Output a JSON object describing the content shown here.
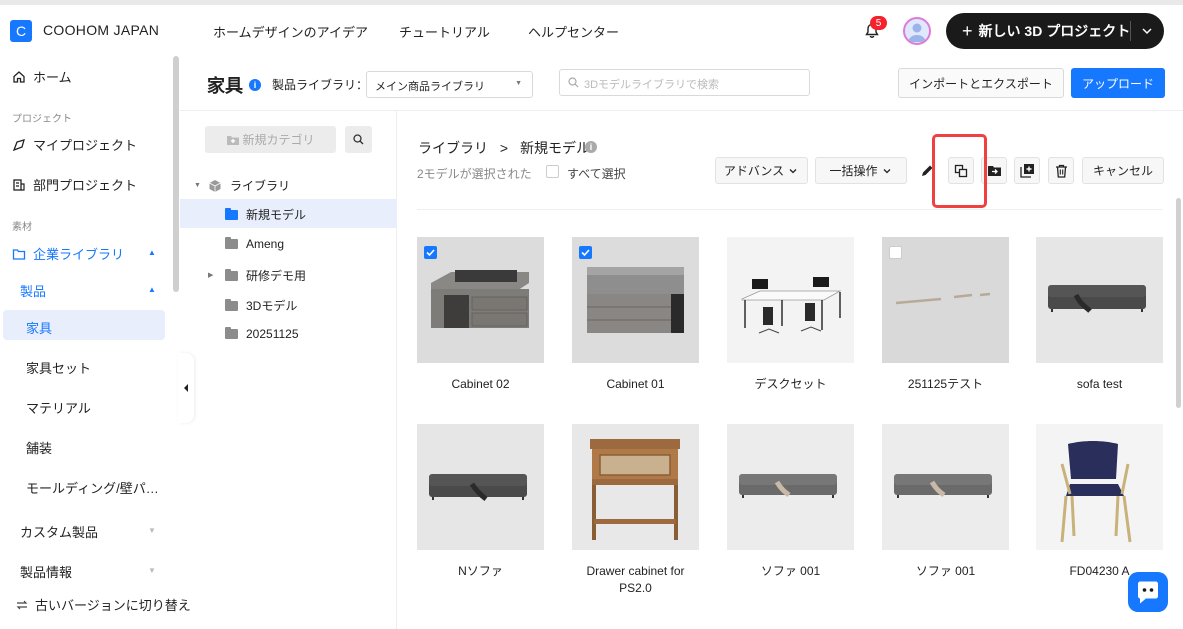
{
  "brand": {
    "logo_letter": "C",
    "name": "COOHOM JAPAN"
  },
  "topnav": [
    "ホームデザインのアイデア",
    "チュートリアル",
    "ヘルプセンター"
  ],
  "notifications": {
    "count": "5"
  },
  "new_project": {
    "plus": "+",
    "label": "新しい 3D プロジェクト"
  },
  "sidebar": {
    "home": "ホーム",
    "section_project": "プロジェクト",
    "my_project": "マイプロジェクト",
    "dept_project": "部門プロジェクト",
    "section_material": "素材",
    "enterprise_library": "企業ライブラリ",
    "products": "製品",
    "furniture": "家具",
    "furniture_set": "家具セット",
    "material": "マテリアル",
    "paving": "舗装",
    "molding": "モールディング/壁パ…",
    "custom_products": "カスタム製品",
    "product_info": "製品情報",
    "switch_old": "古いバージョンに切り替え"
  },
  "header": {
    "title": "家具",
    "lib_label": "製品ライブラリ：",
    "lib_value": "メイン商品ライブラリ",
    "search_placeholder": "3Dモデルライブラリで検索",
    "import_export": "インポートとエクスポート",
    "upload": "アップロード"
  },
  "tree": {
    "new_category": "新規カテゴリ",
    "root": "ライブラリ",
    "items": [
      "新規モデル",
      "Ameng",
      "研修デモ用",
      "3Dモデル",
      "20251125"
    ]
  },
  "main": {
    "breadcrumb_root": "ライブラリ",
    "breadcrumb_sep": ">",
    "breadcrumb_current": "新規モデル",
    "selected_text": "2モデルが選択された",
    "select_all": "すべて選択",
    "advanced": "アドバンス",
    "bulk": "一括操作",
    "cancel": "キャンセル"
  },
  "cards": [
    {
      "label": "Cabinet 02",
      "checked": true
    },
    {
      "label": "Cabinet 01",
      "checked": true
    },
    {
      "label": "デスクセット",
      "checked": false
    },
    {
      "label": "251125テスト",
      "checked": false
    },
    {
      "label": "sofa test",
      "checked": false
    },
    {
      "label": "Nソファ",
      "checked": false
    },
    {
      "label": "Drawer cabinet for PS2.0",
      "checked": false
    },
    {
      "label": "ソファ 001",
      "checked": false
    },
    {
      "label": "ソファ 001",
      "checked": false
    },
    {
      "label": "FD04230 A",
      "checked": false
    }
  ],
  "colors": {
    "accent": "#1677ff",
    "highlight": "#f04040",
    "active_bg": "#e8eefb"
  }
}
